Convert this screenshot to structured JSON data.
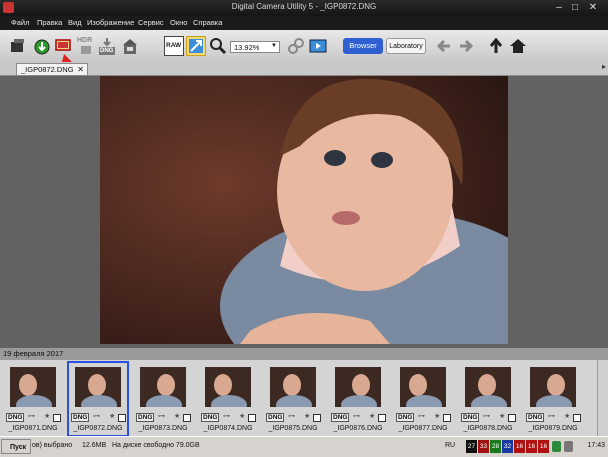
{
  "window": {
    "title": "Digital Camera Utility 5 - _IGP0872.DNG",
    "controls": [
      "–",
      "□",
      "✕"
    ]
  },
  "menu": [
    "Файл",
    "Правка",
    "Вид",
    "Изображение",
    "Сервис",
    "Окно",
    "Справка"
  ],
  "toolbar": {
    "zoom": "13.92%",
    "browser_label": "Browser",
    "laboratory_label": "Laboratory",
    "hdr_label": "HDR",
    "dng_label": "DNG",
    "raw_label": "RAW"
  },
  "tab": {
    "label": "_IGP0872.DNG",
    "close": "✕"
  },
  "date_header": "19 февраля 2017",
  "thumbnails": [
    {
      "name": "_IGP0871.DNG",
      "badge": "DNG"
    },
    {
      "name": "_IGP0872.DNG",
      "badge": "DNG"
    },
    {
      "name": "_IGP0873.DNG",
      "badge": "DNG"
    },
    {
      "name": "_IGP0874.DNG",
      "badge": "DNG"
    },
    {
      "name": "_IGP0875.DNG",
      "badge": "DNG"
    },
    {
      "name": "_IGP0876.DNG",
      "badge": "DNG"
    },
    {
      "name": "_IGP0877.DNG",
      "badge": "DNG"
    },
    {
      "name": "_IGP0878.DNG",
      "badge": "DNG"
    },
    {
      "name": "_IGP0879.DNG",
      "badge": "DNG"
    }
  ],
  "taskbar": {
    "start_label": "Пуск",
    "status_selected": "ов) выбрано",
    "status_size": "12.6MB",
    "status_free": "На диске свободно 79.0GB",
    "lang": "RU",
    "tray_numbers": [
      "27",
      "33",
      "28",
      "32",
      "16",
      "16",
      "16"
    ],
    "clock": "17:43"
  },
  "colors": {
    "selection": "#2b4fe0",
    "browser_button": "#2f5fd0"
  }
}
